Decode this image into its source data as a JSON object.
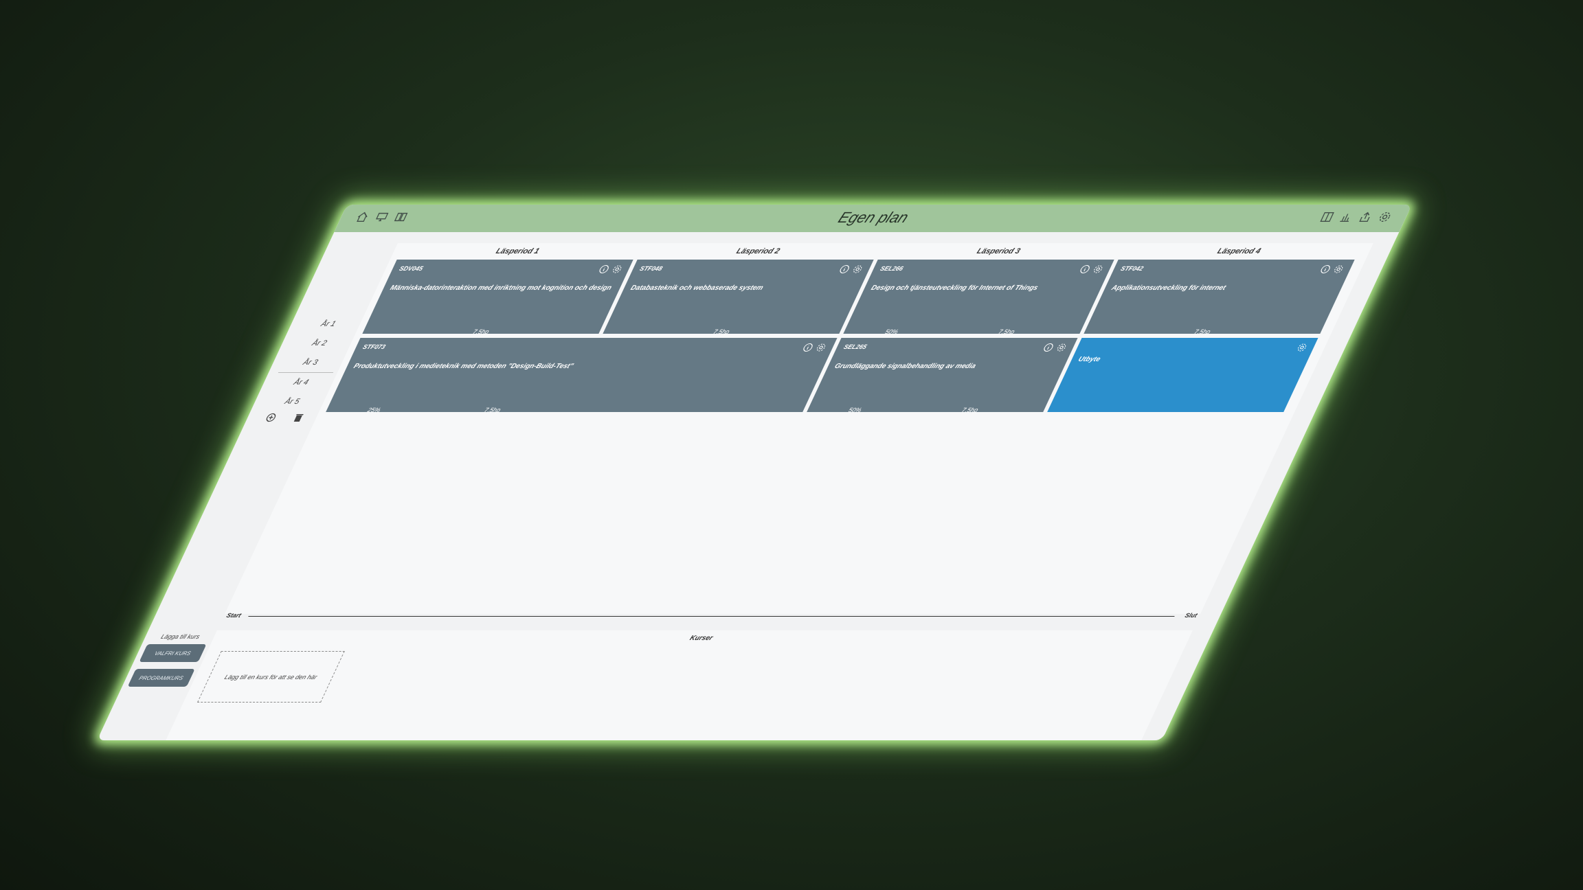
{
  "header": {
    "title": "Egen plan",
    "left_icons": [
      "home-icon",
      "monitor-icon",
      "book-icon"
    ],
    "right_icons": [
      "panel-icon",
      "bar-chart-icon",
      "share-icon",
      "gear-icon"
    ]
  },
  "periods": [
    "Läsperiod 1",
    "Läsperiod 2",
    "Läsperiod 3",
    "Läsperiod 4"
  ],
  "courses_row1": [
    {
      "code": "SDV045",
      "name": "Människa-datorinteraktion med inriktning mot kognition och design",
      "pct": "",
      "hp": "7.5hp"
    },
    {
      "code": "STF048",
      "name": "Databasteknik och webbaserade system",
      "pct": "",
      "hp": "7.5hp"
    },
    {
      "code": "SEL266",
      "name": "Design och tjänsteutveckling för Internet of Things",
      "pct": "50%",
      "hp": "7.5hp"
    },
    {
      "code": "STF042",
      "name": "Applikationsutveckling för internet",
      "pct": "",
      "hp": "7.5hp"
    }
  ],
  "courses_row2": [
    {
      "code": "STF073",
      "name": "Produktutveckling i medieteknik med metoden \"Design-Build-Test\"",
      "pct": "25%",
      "hp": "7.5hp"
    },
    {
      "code": "SEL265",
      "name": "Grundläggande signalbehandling av media",
      "pct": "50%",
      "hp": "7.5hp"
    },
    {
      "code": "",
      "name": "Utbyte",
      "pct": "",
      "hp": ""
    }
  ],
  "years": [
    "År 1",
    "År 2",
    "År 3",
    "År 4",
    "År 5"
  ],
  "timeline": {
    "start": "Start",
    "end": "Slut"
  },
  "add_course": {
    "label": "Lägga till kurs",
    "elective": "VALFRI KURS",
    "program": "PROGRAMKURS"
  },
  "courses_panel": {
    "title": "Kurser",
    "placeholder": "Lägg till en kurs för att se den här"
  },
  "colors": {
    "header": "#a0c59b",
    "card": "#657985",
    "card_highlight": "#2b8fcc",
    "glow": "#b7f08e"
  }
}
